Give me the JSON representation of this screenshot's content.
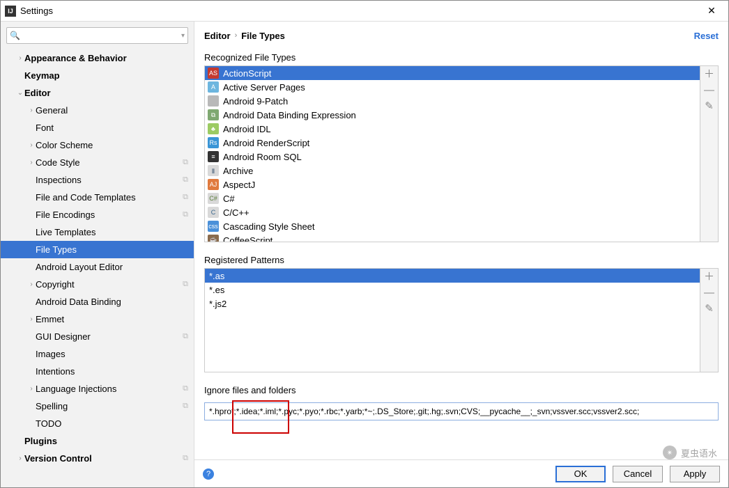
{
  "window": {
    "title": "Settings"
  },
  "search": {
    "placeholder": ""
  },
  "tree": [
    {
      "label": "Appearance & Behavior",
      "indent": 1,
      "chev": "›",
      "bold": true
    },
    {
      "label": "Keymap",
      "indent": 1,
      "chev": "",
      "bold": true
    },
    {
      "label": "Editor",
      "indent": 1,
      "chev": "⌄",
      "bold": true
    },
    {
      "label": "General",
      "indent": 2,
      "chev": "›"
    },
    {
      "label": "Font",
      "indent": 2,
      "chev": ""
    },
    {
      "label": "Color Scheme",
      "indent": 2,
      "chev": "›"
    },
    {
      "label": "Code Style",
      "indent": 2,
      "chev": "›",
      "copy": true
    },
    {
      "label": "Inspections",
      "indent": 2,
      "chev": "",
      "copy": true
    },
    {
      "label": "File and Code Templates",
      "indent": 2,
      "chev": "",
      "copy": true
    },
    {
      "label": "File Encodings",
      "indent": 2,
      "chev": "",
      "copy": true
    },
    {
      "label": "Live Templates",
      "indent": 2,
      "chev": ""
    },
    {
      "label": "File Types",
      "indent": 2,
      "chev": "",
      "selected": true
    },
    {
      "label": "Android Layout Editor",
      "indent": 2,
      "chev": ""
    },
    {
      "label": "Copyright",
      "indent": 2,
      "chev": "›",
      "copy": true
    },
    {
      "label": "Android Data Binding",
      "indent": 2,
      "chev": ""
    },
    {
      "label": "Emmet",
      "indent": 2,
      "chev": "›"
    },
    {
      "label": "GUI Designer",
      "indent": 2,
      "chev": "",
      "copy": true
    },
    {
      "label": "Images",
      "indent": 2,
      "chev": ""
    },
    {
      "label": "Intentions",
      "indent": 2,
      "chev": ""
    },
    {
      "label": "Language Injections",
      "indent": 2,
      "chev": "›",
      "copy": true
    },
    {
      "label": "Spelling",
      "indent": 2,
      "chev": "",
      "copy": true
    },
    {
      "label": "TODO",
      "indent": 2,
      "chev": ""
    },
    {
      "label": "Plugins",
      "indent": 1,
      "chev": "",
      "bold": true
    },
    {
      "label": "Version Control",
      "indent": 1,
      "chev": "›",
      "bold": true,
      "copy": true
    }
  ],
  "breadcrumb": {
    "a": "Editor",
    "b": "File Types",
    "reset": "Reset"
  },
  "sections": {
    "recognized": "Recognized File Types",
    "registered": "Registered Patterns",
    "ignore": "Ignore files and folders"
  },
  "filetypes": [
    {
      "label": "ActionScript",
      "icon_bg": "#c53a2f",
      "icon_txt": "AS",
      "selected": true
    },
    {
      "label": "Active Server Pages",
      "icon_bg": "#6db6df",
      "icon_txt": "A"
    },
    {
      "label": "Android 9-Patch",
      "icon_bg": "#b9b9b9",
      "icon_txt": ""
    },
    {
      "label": "Android Data Binding Expression",
      "icon_bg": "#7fa871",
      "icon_txt": "⧉"
    },
    {
      "label": "Android IDL",
      "icon_bg": "#9ccb63",
      "icon_txt": "♣"
    },
    {
      "label": "Android RenderScript",
      "icon_bg": "#3a95d6",
      "icon_txt": "Rs"
    },
    {
      "label": "Android Room SQL",
      "icon_bg": "#333333",
      "icon_txt": "≡"
    },
    {
      "label": "Archive",
      "icon_bg": "#d9d9d9",
      "icon_txt": "▮",
      "icon_fg": "#7e8e9e"
    },
    {
      "label": "AspectJ",
      "icon_bg": "#e07a3e",
      "icon_txt": "AJ"
    },
    {
      "label": "C#",
      "icon_bg": "#d9d9d9",
      "icon_txt": "C#",
      "icon_fg": "#5a7c3a"
    },
    {
      "label": "C/C++",
      "icon_bg": "#d9d9d9",
      "icon_txt": "C",
      "icon_fg": "#36648b"
    },
    {
      "label": "Cascading Style Sheet",
      "icon_bg": "#4a90d9",
      "icon_txt": "css"
    },
    {
      "label": "CoffeeScript",
      "icon_bg": "#8a6b4d",
      "icon_txt": "☕"
    }
  ],
  "patterns": [
    {
      "label": "*.as",
      "selected": true
    },
    {
      "label": "*.es"
    },
    {
      "label": "*.js2"
    }
  ],
  "ignore_value": "*.hprof;*.idea;*.iml;*.pyc;*.pyo;*.rbc;*.yarb;*~;.DS_Store;.git;.hg;.svn;CVS;__pycache__;_svn;vssver.scc;vssver2.scc;",
  "buttons": {
    "ok": "OK",
    "cancel": "Cancel",
    "apply": "Apply"
  },
  "sidebtns": {
    "add": "＋",
    "remove": "—",
    "edit": "✎"
  },
  "watermark": "夏虫语水"
}
